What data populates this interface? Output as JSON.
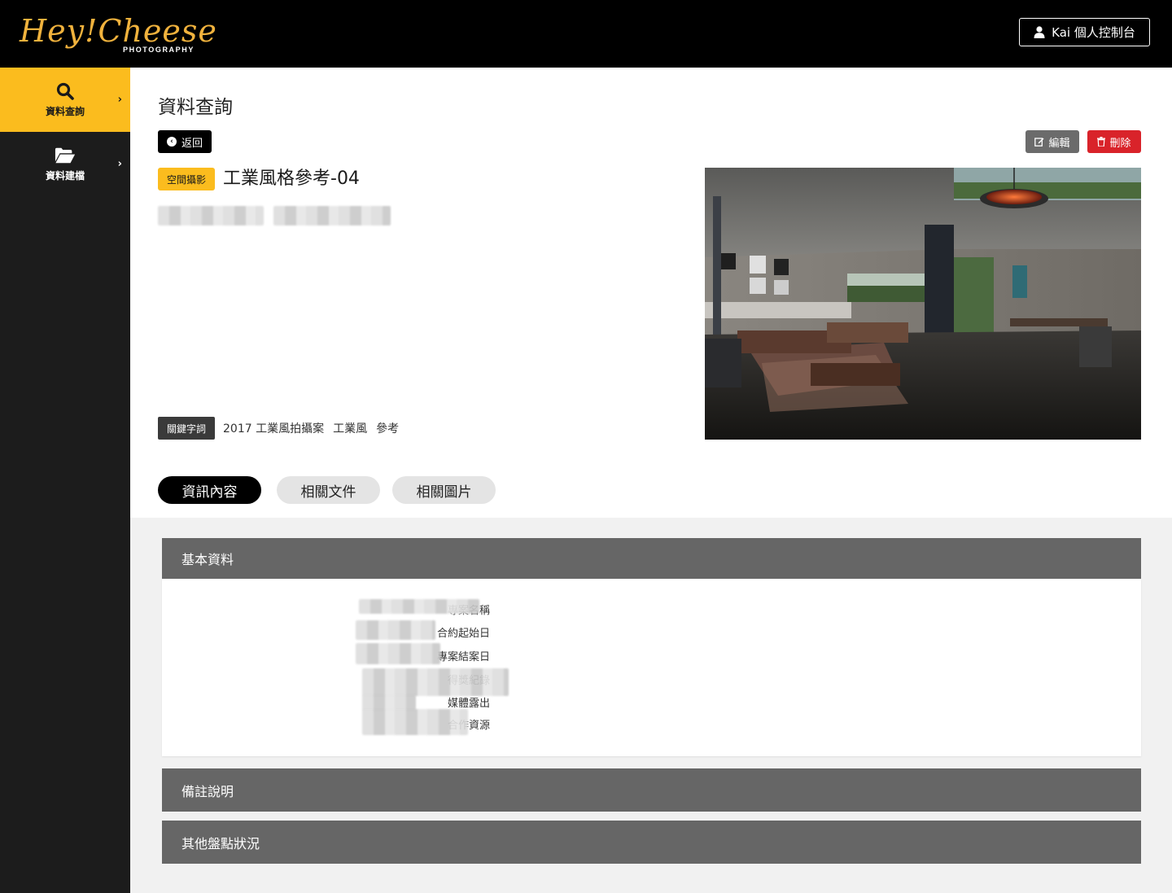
{
  "header": {
    "logo_script": "Hey!Cheese",
    "logo_sub": "PHOTOGRAPHY",
    "user_button_label": "Kai 個人控制台"
  },
  "sidebar": {
    "items": [
      {
        "label": "資料查詢",
        "icon": "search-icon",
        "active": true
      },
      {
        "label": "資料建檔",
        "icon": "folder-open-icon",
        "active": false
      }
    ]
  },
  "page": {
    "title": "資料查詢",
    "back_label": "返回",
    "edit_label": "編輯",
    "delete_label": "刪除"
  },
  "item": {
    "category": "空間攝影",
    "title": "工業風格參考-04",
    "keyword_label": "關鍵字詞",
    "keywords": [
      "2017 工業風拍攝案",
      "工業風",
      "參考"
    ]
  },
  "tabs": [
    {
      "label": "資訊內容",
      "active": true
    },
    {
      "label": "相關文件",
      "active": false
    },
    {
      "label": "相關圖片",
      "active": false
    }
  ],
  "panels": {
    "basic": {
      "title": "基本資料",
      "fields": [
        "專案名稱",
        "合約起始日",
        "專案結案日",
        "得獎紀錄",
        "媒體露出",
        "合作資源"
      ]
    },
    "notes": {
      "title": "備註說明"
    },
    "inventory": {
      "title": "其他盤點狀況"
    }
  },
  "colors": {
    "accent": "#fbbc1e",
    "topbar": "#000000",
    "sidebar": "#1c1c1c",
    "danger": "#d9232a",
    "panel_header": "#666666"
  }
}
